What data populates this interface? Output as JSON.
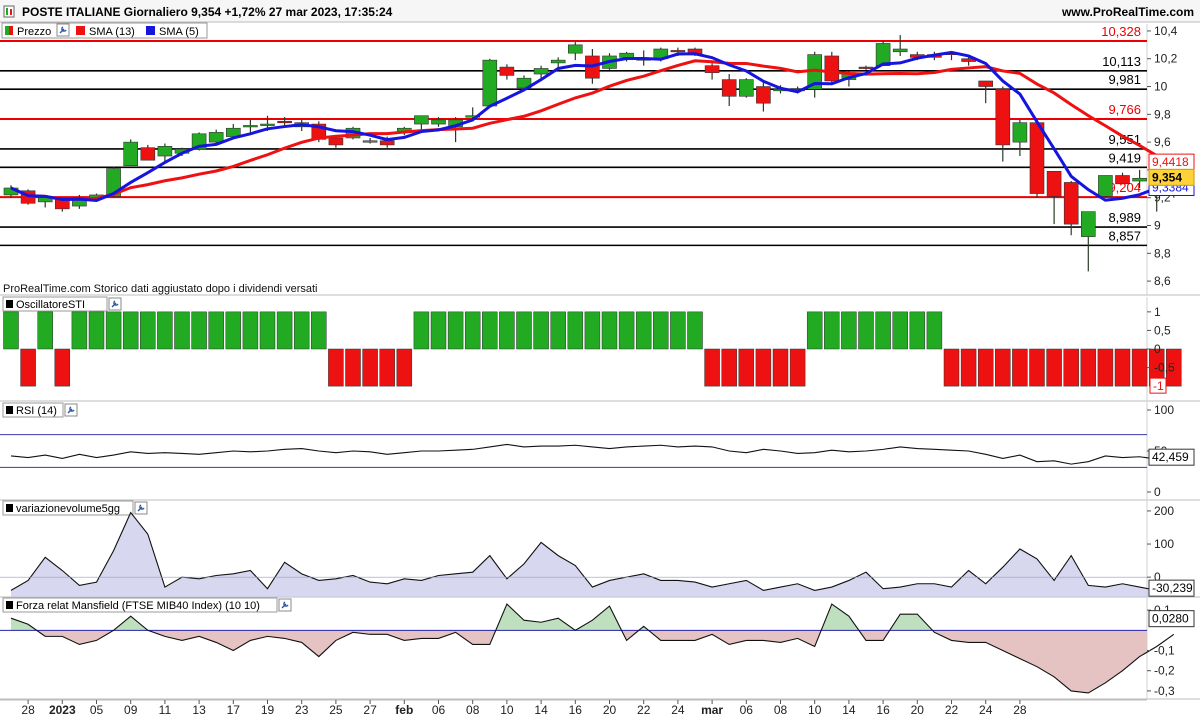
{
  "header": {
    "title": "POSTE ITALIANE Giornaliero 9,354 +1,72% 27 mar 2023, 17:35:24",
    "brand": "www.ProRealTime.com"
  },
  "colors": {
    "up": "#22aa22",
    "down": "#ee1111",
    "sma13": "#ee1111",
    "sma5": "#1515dd",
    "rsi": "#111111",
    "hline_black": "#000000",
    "hline_red": "#ee0000",
    "volume_fill": "#c9c9ea",
    "mansfield_pos": "#bfe0bf",
    "mansfield_neg": "#e6c3c3"
  },
  "chart_data": [
    {
      "type": "candlestick",
      "panel": "price",
      "legend": [
        {
          "label": "Prezzo",
          "color": "#22aa22",
          "icon": "candle-icon"
        },
        {
          "label": "SMA (13)",
          "color": "#ee1111",
          "icon": "wrench-icon"
        },
        {
          "label": "SMA (5)",
          "color": "#1515dd",
          "icon": "wrench-icon"
        }
      ],
      "note": "ProRealTime.com  Storico dati aggiustato dopo i dividendi versati",
      "ylim": [
        8.5,
        10.45
      ],
      "yticks": [
        {
          "v": 10.4,
          "t": "10,4"
        },
        {
          "v": 10.2,
          "t": "10,2"
        },
        {
          "v": 10,
          "t": "10"
        },
        {
          "v": 9.8,
          "t": "9,8"
        },
        {
          "v": 9.6,
          "t": "9,6"
        },
        {
          "v": 9.4,
          "t": "9,4"
        },
        {
          "v": 9.2,
          "t": "9,2"
        },
        {
          "v": 9,
          "t": "9"
        },
        {
          "v": 8.8,
          "t": "8,8"
        },
        {
          "v": 8.6,
          "t": "8,6"
        }
      ],
      "levels": [
        {
          "v": 10.328,
          "t": "10,328",
          "color": "red"
        },
        {
          "v": 10.113,
          "t": "10,113",
          "color": "black"
        },
        {
          "v": 9.981,
          "t": "9,981",
          "color": "black"
        },
        {
          "v": 9.766,
          "t": "9,766",
          "color": "red"
        },
        {
          "v": 9.551,
          "t": "9,551",
          "color": "black"
        },
        {
          "v": 9.419,
          "t": "9,419",
          "color": "black"
        },
        {
          "v": 9.204,
          "t": "9,204",
          "color": "red"
        },
        {
          "v": 8.989,
          "t": "8,989",
          "color": "black"
        },
        {
          "v": 8.857,
          "t": "8,857",
          "color": "black"
        }
      ],
      "last_values": [
        {
          "v": 9.4418,
          "t": "9,4418",
          "kind": "sma13"
        },
        {
          "v": 9.354,
          "t": "9,354",
          "kind": "price"
        },
        {
          "v": 9.3384,
          "t": "9,3384",
          "kind": "sma5"
        }
      ],
      "ohlc": [
        [
          9.22,
          9.29,
          9.2,
          9.27
        ],
        [
          9.25,
          9.26,
          9.15,
          9.16
        ],
        [
          9.17,
          9.22,
          9.13,
          9.2
        ],
        [
          9.19,
          9.2,
          9.1,
          9.12
        ],
        [
          9.14,
          9.22,
          9.12,
          9.2
        ],
        [
          9.2,
          9.23,
          9.19,
          9.22
        ],
        [
          9.21,
          9.42,
          9.2,
          9.41
        ],
        [
          9.43,
          9.62,
          9.43,
          9.6
        ],
        [
          9.56,
          9.58,
          9.47,
          9.47
        ],
        [
          9.5,
          9.59,
          9.46,
          9.57
        ],
        [
          9.52,
          9.56,
          9.5,
          9.55
        ],
        [
          9.55,
          9.67,
          9.54,
          9.66
        ],
        [
          9.6,
          9.69,
          9.58,
          9.67
        ],
        [
          9.64,
          9.73,
          9.62,
          9.7
        ],
        [
          9.71,
          9.76,
          9.67,
          9.72
        ],
        [
          9.73,
          9.79,
          9.68,
          9.73
        ],
        [
          9.75,
          9.78,
          9.72,
          9.74
        ],
        [
          9.71,
          9.76,
          9.68,
          9.74
        ],
        [
          9.73,
          9.75,
          9.6,
          9.62
        ],
        [
          9.63,
          9.65,
          9.56,
          9.58
        ],
        [
          9.63,
          9.71,
          9.62,
          9.7
        ],
        [
          9.61,
          9.63,
          9.59,
          9.61
        ],
        [
          9.61,
          9.64,
          9.56,
          9.58
        ],
        [
          9.67,
          9.71,
          9.65,
          9.7
        ],
        [
          9.73,
          9.79,
          9.67,
          9.79
        ],
        [
          9.73,
          9.78,
          9.71,
          9.76
        ],
        [
          9.71,
          9.78,
          9.6,
          9.76
        ],
        [
          9.79,
          9.85,
          9.75,
          9.79
        ],
        [
          9.86,
          10.2,
          9.85,
          10.19
        ],
        [
          10.14,
          10.16,
          10.05,
          10.08
        ],
        [
          9.99,
          10.08,
          9.98,
          10.06
        ],
        [
          10.09,
          10.15,
          10.06,
          10.13
        ],
        [
          10.17,
          10.21,
          10.14,
          10.19
        ],
        [
          10.24,
          10.32,
          10.19,
          10.3
        ],
        [
          10.22,
          10.27,
          10.02,
          10.06
        ],
        [
          10.13,
          10.24,
          10.12,
          10.22
        ],
        [
          10.21,
          10.25,
          10.18,
          10.24
        ],
        [
          10.2,
          10.26,
          10.15,
          10.19
        ],
        [
          10.2,
          10.28,
          10.18,
          10.27
        ],
        [
          10.26,
          10.28,
          10.22,
          10.25
        ],
        [
          10.27,
          10.28,
          10.22,
          10.23
        ],
        [
          10.15,
          10.17,
          10.05,
          10.1
        ],
        [
          10.05,
          10.09,
          9.86,
          9.93
        ],
        [
          9.93,
          10.06,
          9.92,
          10.05
        ],
        [
          10,
          10.03,
          9.82,
          9.88
        ],
        [
          9.97,
          10.01,
          9.95,
          9.98
        ],
        [
          9.98,
          10,
          9.95,
          9.97
        ],
        [
          9.98,
          10.25,
          9.92,
          10.23
        ],
        [
          10.22,
          10.25,
          10.02,
          10.04
        ],
        [
          10.05,
          10.11,
          10.0,
          10.1
        ],
        [
          10.14,
          10.15,
          10.12,
          10.13
        ],
        [
          10.15,
          10.33,
          10.15,
          10.31
        ],
        [
          10.25,
          10.37,
          10.22,
          10.27
        ],
        [
          10.23,
          10.25,
          10.19,
          10.21
        ],
        [
          10.23,
          10.25,
          10.19,
          10.21
        ],
        [
          10.24,
          10.25,
          10.19,
          10.23
        ],
        [
          10.2,
          10.22,
          10.15,
          10.18
        ],
        [
          10.04,
          10.04,
          9.88,
          10.0
        ],
        [
          9.98,
          10.0,
          9.46,
          9.58
        ],
        [
          9.6,
          9.76,
          9.5,
          9.74
        ],
        [
          9.74,
          9.76,
          9.2,
          9.23
        ],
        [
          9.39,
          9.39,
          9.01,
          9.21
        ],
        [
          9.31,
          9.32,
          8.93,
          9.01
        ],
        [
          8.92,
          9.08,
          8.67,
          9.1
        ],
        [
          9.21,
          9.36,
          9.2,
          9.36
        ],
        [
          9.36,
          9.38,
          9.3,
          9.3
        ],
        [
          9.32,
          9.4,
          9.27,
          9.34
        ],
        [
          9.33,
          9.34,
          9.1,
          9.25
        ],
        [
          9.28,
          9.36,
          9.2,
          9.35
        ]
      ]
    },
    {
      "type": "bar",
      "panel": "oscillator",
      "title": "OscillatoreSTI",
      "ylim": [
        -1.4,
        1.4
      ],
      "yticks": [
        {
          "v": 1,
          "t": "1"
        },
        {
          "v": 0.5,
          "t": "0,5"
        },
        {
          "v": 0,
          "t": "0"
        },
        {
          "v": -0.5,
          "t": "-0,5"
        }
      ],
      "last_value": {
        "v": -1,
        "t": "-1"
      },
      "values": [
        1,
        -1,
        1,
        -1,
        1,
        1,
        1,
        1,
        1,
        1,
        1,
        1,
        1,
        1,
        1,
        1,
        1,
        1,
        1,
        -1,
        -1,
        -1,
        -1,
        -1,
        1,
        1,
        1,
        1,
        1,
        1,
        1,
        1,
        1,
        1,
        1,
        1,
        1,
        1,
        1,
        1,
        1,
        -1,
        -1,
        -1,
        -1,
        -1,
        -1,
        1,
        1,
        1,
        1,
        1,
        1,
        1,
        1,
        -1,
        -1,
        -1,
        -1,
        -1,
        -1,
        -1,
        -1,
        -1,
        -1,
        -1,
        -1,
        -1,
        -1
      ]
    },
    {
      "type": "line",
      "panel": "rsi",
      "title": "RSI (14)",
      "ylim": [
        0,
        100
      ],
      "yticks": [
        {
          "v": 100,
          "t": "100"
        },
        {
          "v": 50,
          "t": "50"
        },
        {
          "v": 0,
          "t": "0"
        }
      ],
      "bands": [
        70,
        30
      ],
      "last_value": {
        "v": 42.459,
        "t": "42,459"
      },
      "values": [
        44,
        42,
        45,
        41,
        46,
        42,
        45,
        49,
        47,
        48,
        47,
        46,
        48,
        50,
        49,
        50,
        52,
        53,
        50,
        48,
        50,
        49,
        46,
        48,
        50,
        50,
        51,
        52,
        55,
        58,
        55,
        56,
        56,
        57,
        55,
        53,
        55,
        56,
        57,
        55,
        56,
        55,
        50,
        48,
        52,
        50,
        47,
        48,
        51,
        49,
        50,
        52,
        55,
        53,
        52,
        51,
        50,
        46,
        41,
        45,
        37,
        38,
        34,
        37,
        44,
        42,
        43,
        40,
        42
      ]
    },
    {
      "type": "area",
      "panel": "volume",
      "title": "variazionevolume5gg",
      "ylim": [
        -60,
        230
      ],
      "yticks": [
        {
          "v": 200,
          "t": "200"
        },
        {
          "v": 100,
          "t": "100"
        },
        {
          "v": 0,
          "t": "0"
        }
      ],
      "last_value": {
        "v": -30.239,
        "t": "-30,239"
      },
      "values": [
        -40,
        -10,
        60,
        20,
        -25,
        -15,
        80,
        195,
        130,
        -30,
        0,
        -5,
        5,
        10,
        20,
        -35,
        45,
        10,
        -10,
        -5,
        5,
        -15,
        -20,
        -5,
        -10,
        5,
        10,
        15,
        65,
        -5,
        40,
        105,
        65,
        35,
        -30,
        -10,
        0,
        10,
        -10,
        -10,
        -15,
        -30,
        -20,
        -10,
        -40,
        -30,
        -20,
        -40,
        -30,
        -10,
        15,
        -35,
        -30,
        -20,
        -20,
        -30,
        20,
        -20,
        30,
        85,
        55,
        -10,
        65,
        -25,
        -30,
        -20,
        -30,
        -40,
        -30
      ]
    },
    {
      "type": "area",
      "panel": "mansfield",
      "title": "Forza relat Mansfield (FTSE MIB40 Index) (10 10)",
      "ylim": [
        -0.34,
        0.16
      ],
      "yticks": [
        {
          "v": 0.1,
          "t": "0,1"
        },
        {
          "v": -0.1,
          "t": "-0,1"
        },
        {
          "v": -0.2,
          "t": "-0,2"
        },
        {
          "v": -0.3,
          "t": "-0,3"
        }
      ],
      "last_value": {
        "v": 0.028,
        "t": "0,0280"
      },
      "values": [
        0.06,
        0.03,
        -0.03,
        -0.03,
        -0.07,
        -0.05,
        0.0,
        0.07,
        0.0,
        -0.03,
        -0.05,
        -0.03,
        -0.06,
        -0.1,
        -0.05,
        -0.03,
        -0.04,
        -0.06,
        -0.13,
        -0.05,
        -0.01,
        -0.02,
        -0.02,
        -0.05,
        -0.04,
        -0.04,
        -0.01,
        -0.07,
        -0.07,
        0.13,
        0.05,
        0.04,
        0.06,
        0.0,
        0.05,
        0.12,
        -0.05,
        0.02,
        -0.05,
        -0.05,
        -0.05,
        -0.02,
        -0.07,
        -0.05,
        -0.05,
        -0.06,
        -0.04,
        -0.08,
        0.13,
        0.07,
        -0.05,
        -0.05,
        0.08,
        0.08,
        -0.01,
        -0.05,
        -0.06,
        -0.06,
        -0.1,
        -0.14,
        -0.18,
        -0.23,
        -0.3,
        -0.31,
        -0.26,
        -0.2,
        -0.13,
        -0.08,
        -0.02
      ]
    }
  ],
  "x_axis": {
    "labels": [
      {
        "i": 1,
        "t": "28",
        "bold": false
      },
      {
        "i": 3,
        "t": "2023",
        "bold": true
      },
      {
        "i": 5,
        "t": "05",
        "bold": false
      },
      {
        "i": 7,
        "t": "09",
        "bold": false
      },
      {
        "i": 9,
        "t": "11",
        "bold": false
      },
      {
        "i": 11,
        "t": "13",
        "bold": false
      },
      {
        "i": 13,
        "t": "17",
        "bold": false
      },
      {
        "i": 15,
        "t": "19",
        "bold": false
      },
      {
        "i": 17,
        "t": "23",
        "bold": false
      },
      {
        "i": 19,
        "t": "25",
        "bold": false
      },
      {
        "i": 21,
        "t": "27",
        "bold": false
      },
      {
        "i": 23,
        "t": "feb",
        "bold": true
      },
      {
        "i": 25,
        "t": "06",
        "bold": false
      },
      {
        "i": 27,
        "t": "08",
        "bold": false
      },
      {
        "i": 29,
        "t": "10",
        "bold": false
      },
      {
        "i": 31,
        "t": "14",
        "bold": false
      },
      {
        "i": 33,
        "t": "16",
        "bold": false
      },
      {
        "i": 35,
        "t": "20",
        "bold": false
      },
      {
        "i": 37,
        "t": "22",
        "bold": false
      },
      {
        "i": 39,
        "t": "24",
        "bold": false
      },
      {
        "i": 41,
        "t": "mar",
        "bold": true
      },
      {
        "i": 43,
        "t": "06",
        "bold": false
      },
      {
        "i": 45,
        "t": "08",
        "bold": false
      },
      {
        "i": 47,
        "t": "10",
        "bold": false
      },
      {
        "i": 49,
        "t": "14",
        "bold": false
      },
      {
        "i": 51,
        "t": "16",
        "bold": false
      },
      {
        "i": 53,
        "t": "20",
        "bold": false
      },
      {
        "i": 55,
        "t": "22",
        "bold": false
      },
      {
        "i": 57,
        "t": "24",
        "bold": false
      },
      {
        "i": 59,
        "t": "28",
        "bold": false
      }
    ]
  }
}
